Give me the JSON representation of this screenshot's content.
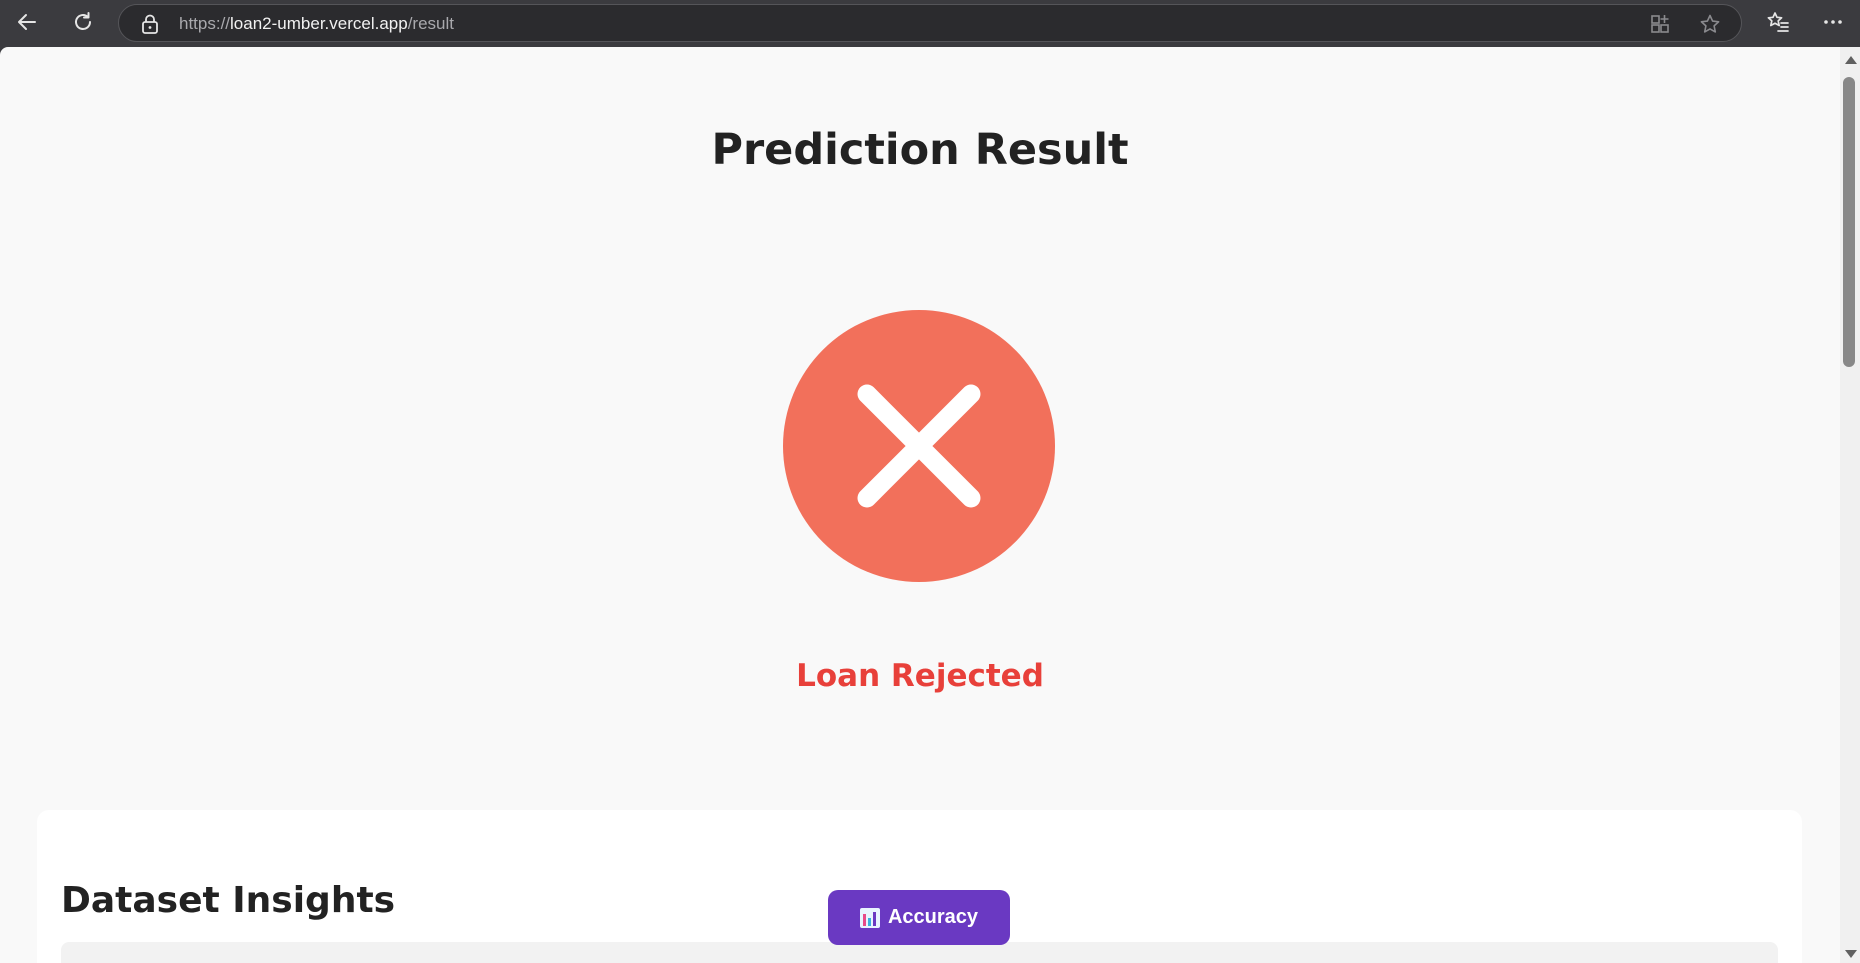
{
  "browser": {
    "url_scheme": "https://",
    "url_host": "loan2-umber.vercel.app",
    "url_path": "/result"
  },
  "page": {
    "title": "Prediction Result",
    "result_label": "Loan Rejected",
    "result_icon": "close-icon",
    "colors": {
      "reject_circle": "#f2705b",
      "reject_text": "#e8403a",
      "accent_button": "#6a39c2"
    }
  },
  "insights": {
    "title": "Dataset Insights"
  },
  "accuracy_button": {
    "label": "Accuracy",
    "icon": "bar-chart-icon"
  }
}
